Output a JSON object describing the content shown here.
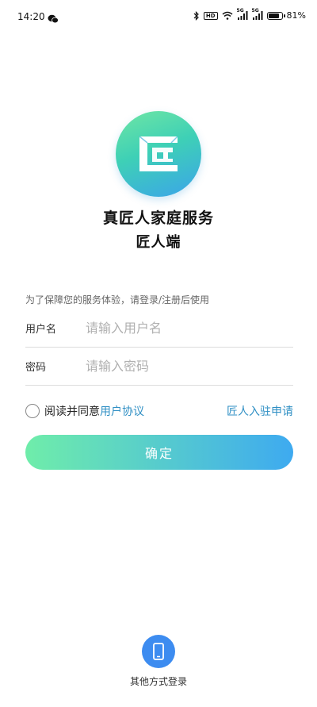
{
  "status_bar": {
    "time": "14:20",
    "battery_percent": "81%",
    "battery_level": 0.81,
    "hd_badge": "HD",
    "network_1": "5G",
    "network_2": "5G"
  },
  "brand": {
    "title": "真匠人家庭服务",
    "subtitle": "匠人端"
  },
  "form": {
    "hint": "为了保障您的服务体验，请登录/注册后使用",
    "username_label": "用户名",
    "username_placeholder": "请输入用户名",
    "username_value": "",
    "password_label": "密码",
    "password_placeholder": "请输入密码",
    "password_value": ""
  },
  "agreement": {
    "prefix": "阅读并同意",
    "link": "用户协议",
    "checked": false
  },
  "apply_link": "匠人入驻申请",
  "confirm_button": "确定",
  "other_login_label": "其他方式登录",
  "colors": {
    "accent_blue": "#2f8fc4",
    "gradient_start": "#6fedaa",
    "gradient_end": "#3eaaf0",
    "phone_button": "#3d8cf0"
  },
  "icons": [
    "wechat-icon",
    "bluetooth-icon",
    "wifi-icon",
    "signal-icon",
    "battery-icon",
    "logo-icon",
    "phone-icon"
  ]
}
